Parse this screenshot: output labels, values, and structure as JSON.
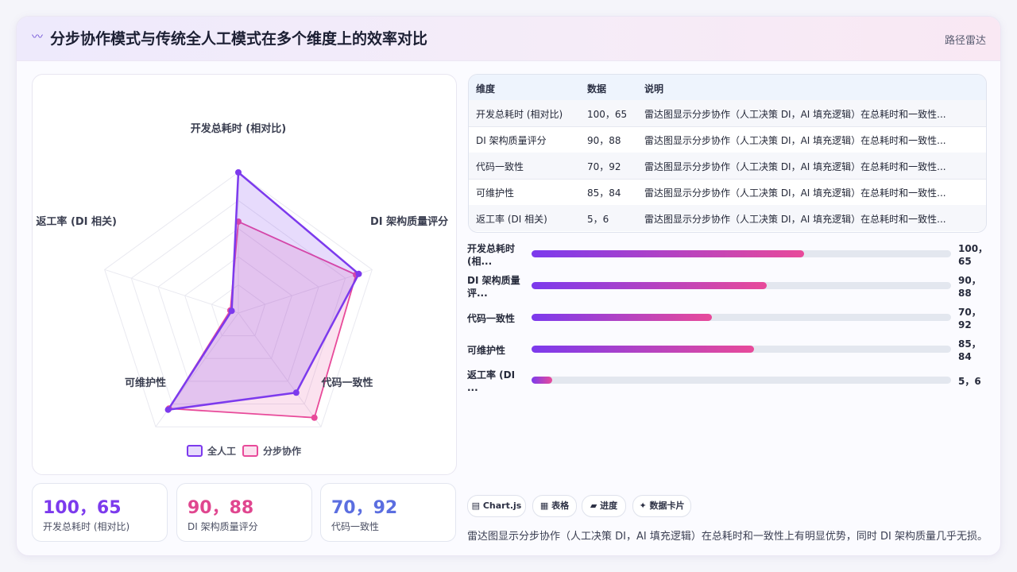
{
  "header": {
    "icon": "wave-icon",
    "title": "分步协作模式与传统全人工模式在多个维度上的效率对比",
    "tag": "路径雷达"
  },
  "chart_data": {
    "type": "radar",
    "axes": [
      "开发总耗时 (相对比)",
      "DI 架构质量评分",
      "代码一致性",
      "可维护性",
      "返工率 (DI 相关)"
    ],
    "range": [
      0,
      100
    ],
    "grid": true,
    "legend_position": "bottom",
    "series": [
      {
        "name": "全人工",
        "values": [
          100,
          90,
          70,
          85,
          5
        ],
        "color": "#7c3aed"
      },
      {
        "name": "分步协作",
        "values": [
          65,
          88,
          92,
          84,
          6
        ],
        "color": "#e84a9a"
      }
    ]
  },
  "table": {
    "headers": [
      "维度",
      "数据",
      "说明"
    ],
    "rows": [
      [
        "开发总耗时 (相对比)",
        "100，65",
        "雷达图显示分步协作（人工决策 DI，AI 填充逻辑）在总耗时和一致性..."
      ],
      [
        "DI 架构质量评分",
        "90，88",
        "雷达图显示分步协作（人工决策 DI，AI 填充逻辑）在总耗时和一致性..."
      ],
      [
        "代码一致性",
        "70，92",
        "雷达图显示分步协作（人工决策 DI，AI 填充逻辑）在总耗时和一致性..."
      ],
      [
        "可维护性",
        "85，84",
        "雷达图显示分步协作（人工决策 DI，AI 填充逻辑）在总耗时和一致性..."
      ],
      [
        "返工率 (DI 相关)",
        "5，6",
        "雷达图显示分步协作（人工决策 DI，AI 填充逻辑）在总耗时和一致性..."
      ]
    ]
  },
  "bars": [
    {
      "label": "开发总耗时 (相...",
      "value": "100，65",
      "percent": 65
    },
    {
      "label": "DI 架构质量评...",
      "value": "90，88",
      "percent": 56
    },
    {
      "label": "代码一致性",
      "value": "70，92",
      "percent": 43
    },
    {
      "label": "可维护性",
      "value": "85，84",
      "percent": 53
    },
    {
      "label": "返工率 (DI ...",
      "value": "5，6",
      "percent": 5
    }
  ],
  "kpis": [
    {
      "value": "100，65",
      "label": "开发总耗时 (相对比)",
      "color": "#7c3aed"
    },
    {
      "value": "90，88",
      "label": "DI 架构质量评分",
      "color": "#e0468f"
    },
    {
      "value": "70，92",
      "label": "代码一致性",
      "color": "#5b6ee0"
    }
  ],
  "chips": [
    {
      "icon": "table-icon",
      "label": "▤ Chart.js"
    },
    {
      "icon": "grid-icon",
      "label": "▦ 表格"
    },
    {
      "icon": "progress-icon",
      "label": "▰ 进度"
    },
    {
      "icon": "sparkle-icon",
      "label": "✦ 数据卡片"
    }
  ],
  "summary": "雷达图显示分步协作（人工决策 DI，AI 填充逻辑）在总耗时和一致性上有明显优势，同时 DI 架构质量几乎无损。"
}
